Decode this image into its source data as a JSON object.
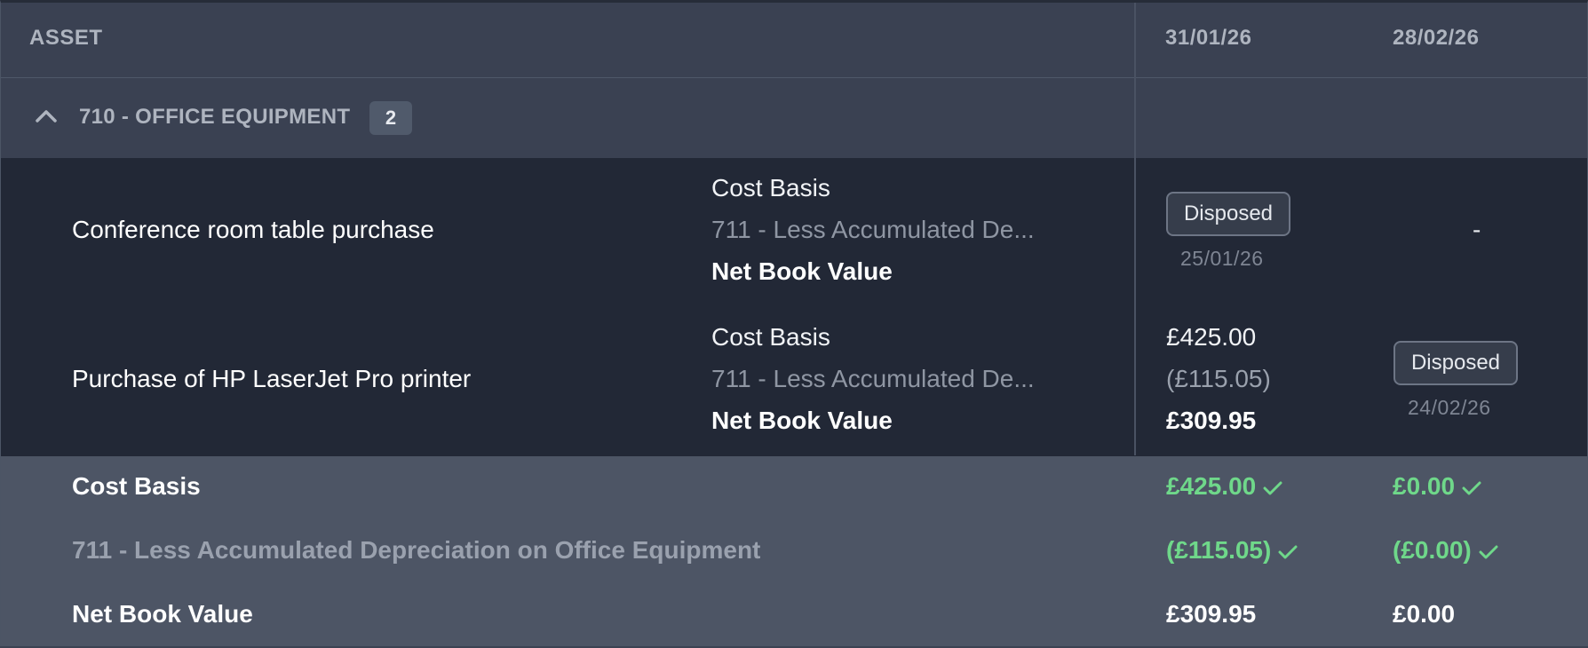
{
  "header": {
    "asset_col": "ASSET",
    "date_cols": [
      "31/01/26",
      "28/02/26"
    ]
  },
  "group": {
    "title": "710 - OFFICE EQUIPMENT",
    "count": "2"
  },
  "labels": {
    "cost": "Cost Basis",
    "dep": "711 - Less Accumulated De...",
    "nbv": "Net Book Value"
  },
  "assets": [
    {
      "name": "Conference room table purchase",
      "col1": {
        "status": "Disposed",
        "date": "25/01/26"
      },
      "col2": {
        "dash": "-"
      }
    },
    {
      "name": "Purchase of HP LaserJet Pro printer",
      "col1": {
        "cost": "£425.00",
        "dep": "(£115.05)",
        "nbv": "£309.95"
      },
      "col2": {
        "status": "Disposed",
        "date": "24/02/26"
      }
    }
  ],
  "summary": {
    "cost_label": "Cost Basis",
    "dep_label": "711 - Less Accumulated Depreciation on Office Equipment",
    "nbv_label": "Net Book Value",
    "col1": {
      "cost": "£425.00",
      "dep": "(£115.05)",
      "nbv": "£309.95"
    },
    "col2": {
      "cost": "£0.00",
      "dep": "(£0.00)",
      "nbv": "£0.00"
    }
  },
  "colors": {
    "reconciled_green": "#6fd88a",
    "background": "#3a4152",
    "row_bg": "#222836",
    "summary_bg": "#4d5565"
  },
  "icons": {
    "collapse": "chevron-up-icon",
    "reconciled": "check-icon"
  }
}
